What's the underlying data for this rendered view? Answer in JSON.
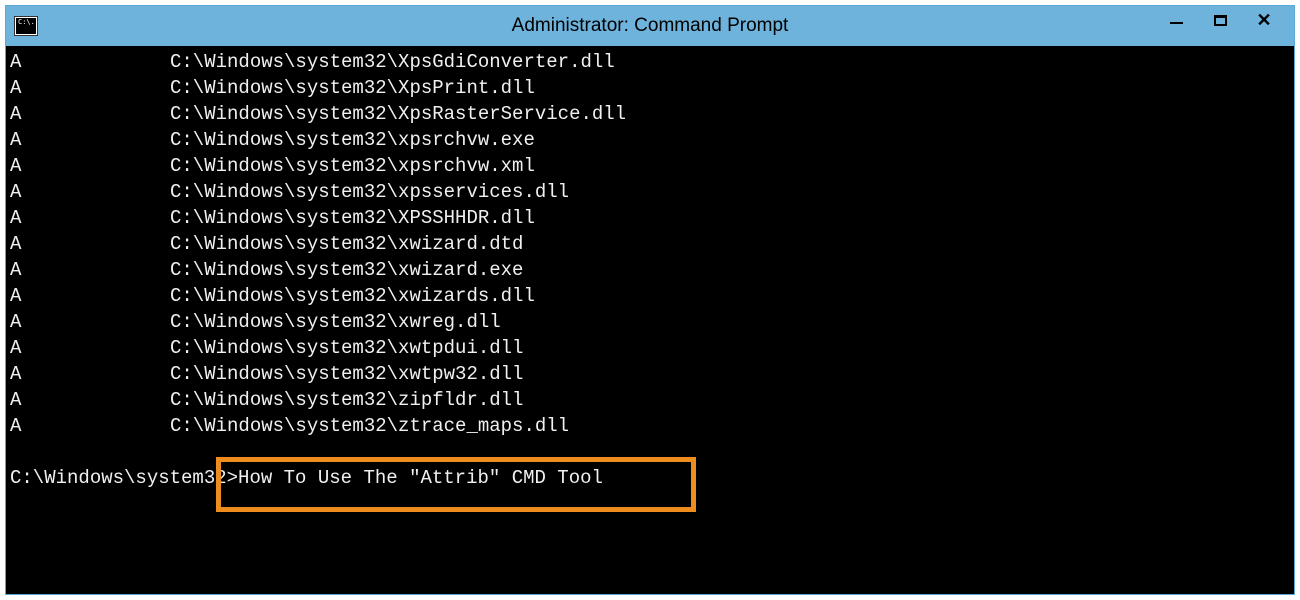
{
  "window": {
    "title": "Administrator: Command Prompt",
    "icon_text": "C:\\."
  },
  "output": {
    "lines": [
      {
        "attr": "A",
        "path": "C:\\Windows\\system32\\XpsGdiConverter.dll"
      },
      {
        "attr": "A",
        "path": "C:\\Windows\\system32\\XpsPrint.dll"
      },
      {
        "attr": "A",
        "path": "C:\\Windows\\system32\\XpsRasterService.dll"
      },
      {
        "attr": "A",
        "path": "C:\\Windows\\system32\\xpsrchvw.exe"
      },
      {
        "attr": "A",
        "path": "C:\\Windows\\system32\\xpsrchvw.xml"
      },
      {
        "attr": "A",
        "path": "C:\\Windows\\system32\\xpsservices.dll"
      },
      {
        "attr": "A",
        "path": "C:\\Windows\\system32\\XPSSHHDR.dll"
      },
      {
        "attr": "A",
        "path": "C:\\Windows\\system32\\xwizard.dtd"
      },
      {
        "attr": "A",
        "path": "C:\\Windows\\system32\\xwizard.exe"
      },
      {
        "attr": "A",
        "path": "C:\\Windows\\system32\\xwizards.dll"
      },
      {
        "attr": "A",
        "path": "C:\\Windows\\system32\\xwreg.dll"
      },
      {
        "attr": "A",
        "path": "C:\\Windows\\system32\\xwtpdui.dll"
      },
      {
        "attr": "A",
        "path": "C:\\Windows\\system32\\xwtpw32.dll"
      },
      {
        "attr": "A",
        "path": "C:\\Windows\\system32\\zipfldr.dll"
      },
      {
        "attr": "A",
        "path": "C:\\Windows\\system32\\ztrace_maps.dll"
      }
    ]
  },
  "prompt": {
    "cwd": "C:\\Windows\\system32>",
    "input": "How To Use The \"Attrib\" CMD Tool"
  }
}
